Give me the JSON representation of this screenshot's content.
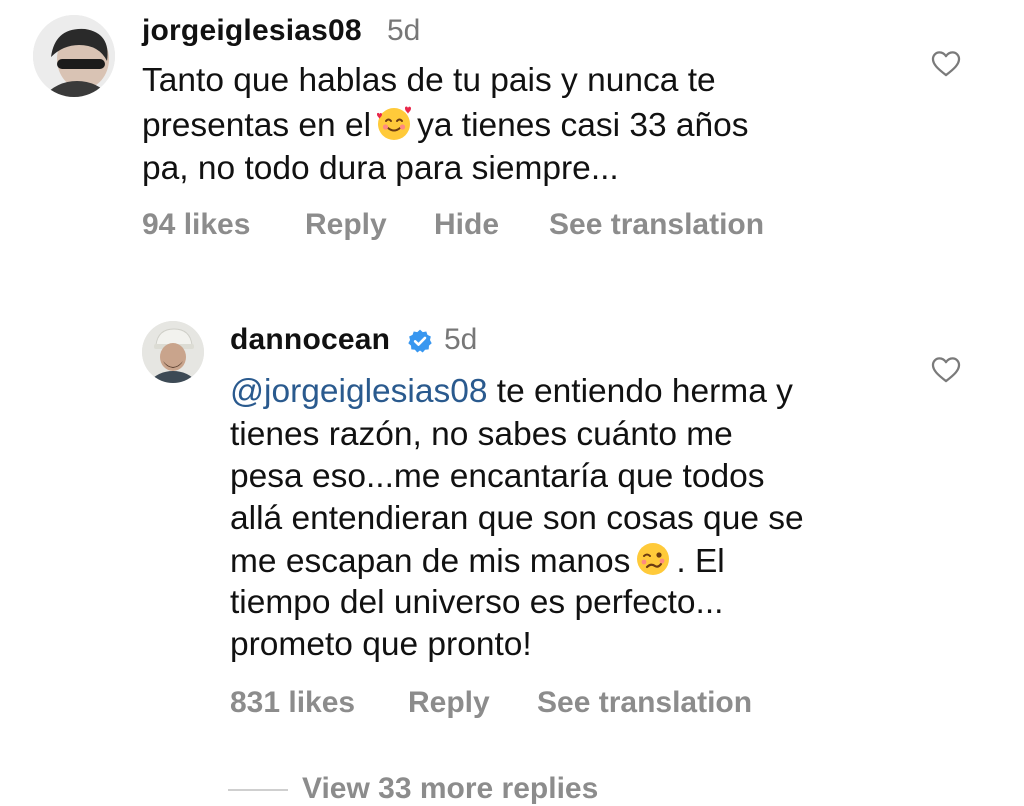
{
  "comments": [
    {
      "username": "jorgeiglesias08",
      "time": "5d",
      "lines": [
        "Tanto que hablas de tu pais y nunca te",
        "presentas en el",
        "ya tienes casi 33 años",
        "pa, no todo dura para siempre..."
      ],
      "emoji_icon": "smiling-face-with-hearts-icon",
      "likes": "94 likes",
      "reply": "Reply",
      "hide": "Hide",
      "translate": "See translation"
    },
    {
      "username": "dannocean",
      "verified": true,
      "time": "5d",
      "mention": "@jorgeiglesias08",
      "lines": [
        "te entiendo herma y",
        "tienes razón, no sabes cuánto me",
        "pesa eso...me encantaría que todos",
        "allá entendieran que son cosas que se",
        "me escapan de mis manos",
        ". El",
        "tiempo del universo es perfecto...",
        "prometo que pronto!"
      ],
      "emoji_icon": "woozy-face-icon",
      "likes": "831 likes",
      "reply": "Reply",
      "translate": "See translation"
    }
  ],
  "view_more": "View 33 more replies",
  "colors": {
    "text": "#111111",
    "secondary": "#8c8c8c",
    "mention": "#2a5a8e",
    "verified": "#3897f0"
  },
  "icons": [
    "heart-outline-icon",
    "verified-badge-icon"
  ]
}
